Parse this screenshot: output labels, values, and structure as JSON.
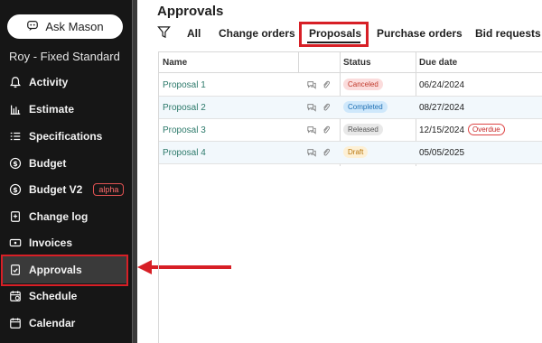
{
  "sidebar": {
    "ask_button": "Ask Mason",
    "project_name": "Roy - Fixed Standard",
    "items": [
      {
        "label": "Activity",
        "icon": "bell-icon"
      },
      {
        "label": "Estimate",
        "icon": "chart-icon"
      },
      {
        "label": "Specifications",
        "icon": "list-icon"
      },
      {
        "label": "Budget",
        "icon": "dollar-icon"
      },
      {
        "label": "Budget V2",
        "icon": "dollar-icon",
        "badge": "alpha"
      },
      {
        "label": "Change log",
        "icon": "changelog-icon"
      },
      {
        "label": "Invoices",
        "icon": "invoice-icon"
      },
      {
        "label": "Approvals",
        "icon": "approval-icon",
        "active": true
      },
      {
        "label": "Schedule",
        "icon": "schedule-icon"
      },
      {
        "label": "Calendar",
        "icon": "calendar-icon"
      }
    ]
  },
  "main": {
    "title": "Approvals",
    "tabs": [
      {
        "label": "All"
      },
      {
        "label": "Change orders"
      },
      {
        "label": "Proposals",
        "active": true
      },
      {
        "label": "Purchase orders"
      },
      {
        "label": "Bid requests"
      }
    ],
    "table": {
      "headers": {
        "name": "Name",
        "status": "Status",
        "due": "Due date"
      },
      "rows": [
        {
          "name": "Proposal 1",
          "status": "Canceled",
          "due": "06/24/2024"
        },
        {
          "name": "Proposal 2",
          "status": "Completed",
          "due": "08/27/2024"
        },
        {
          "name": "Proposal 3",
          "status": "Released",
          "due": "12/15/2024",
          "flag": "Overdue"
        },
        {
          "name": "Proposal 4",
          "status": "Draft",
          "due": "05/05/2025"
        }
      ]
    }
  },
  "colors": {
    "sidebar_bg": "#161616",
    "highlight_red": "#d71f26",
    "link_green": "#2d7a6b",
    "status_canceled_bg": "#fbdcdc",
    "status_canceled_fg": "#c0392b",
    "status_completed_bg": "#cfe8fb",
    "status_completed_fg": "#1e6fb3",
    "status_released_bg": "#e8e8e8",
    "status_released_fg": "#555555",
    "status_draft_bg": "#fdf0d5",
    "status_draft_fg": "#b9770e"
  }
}
